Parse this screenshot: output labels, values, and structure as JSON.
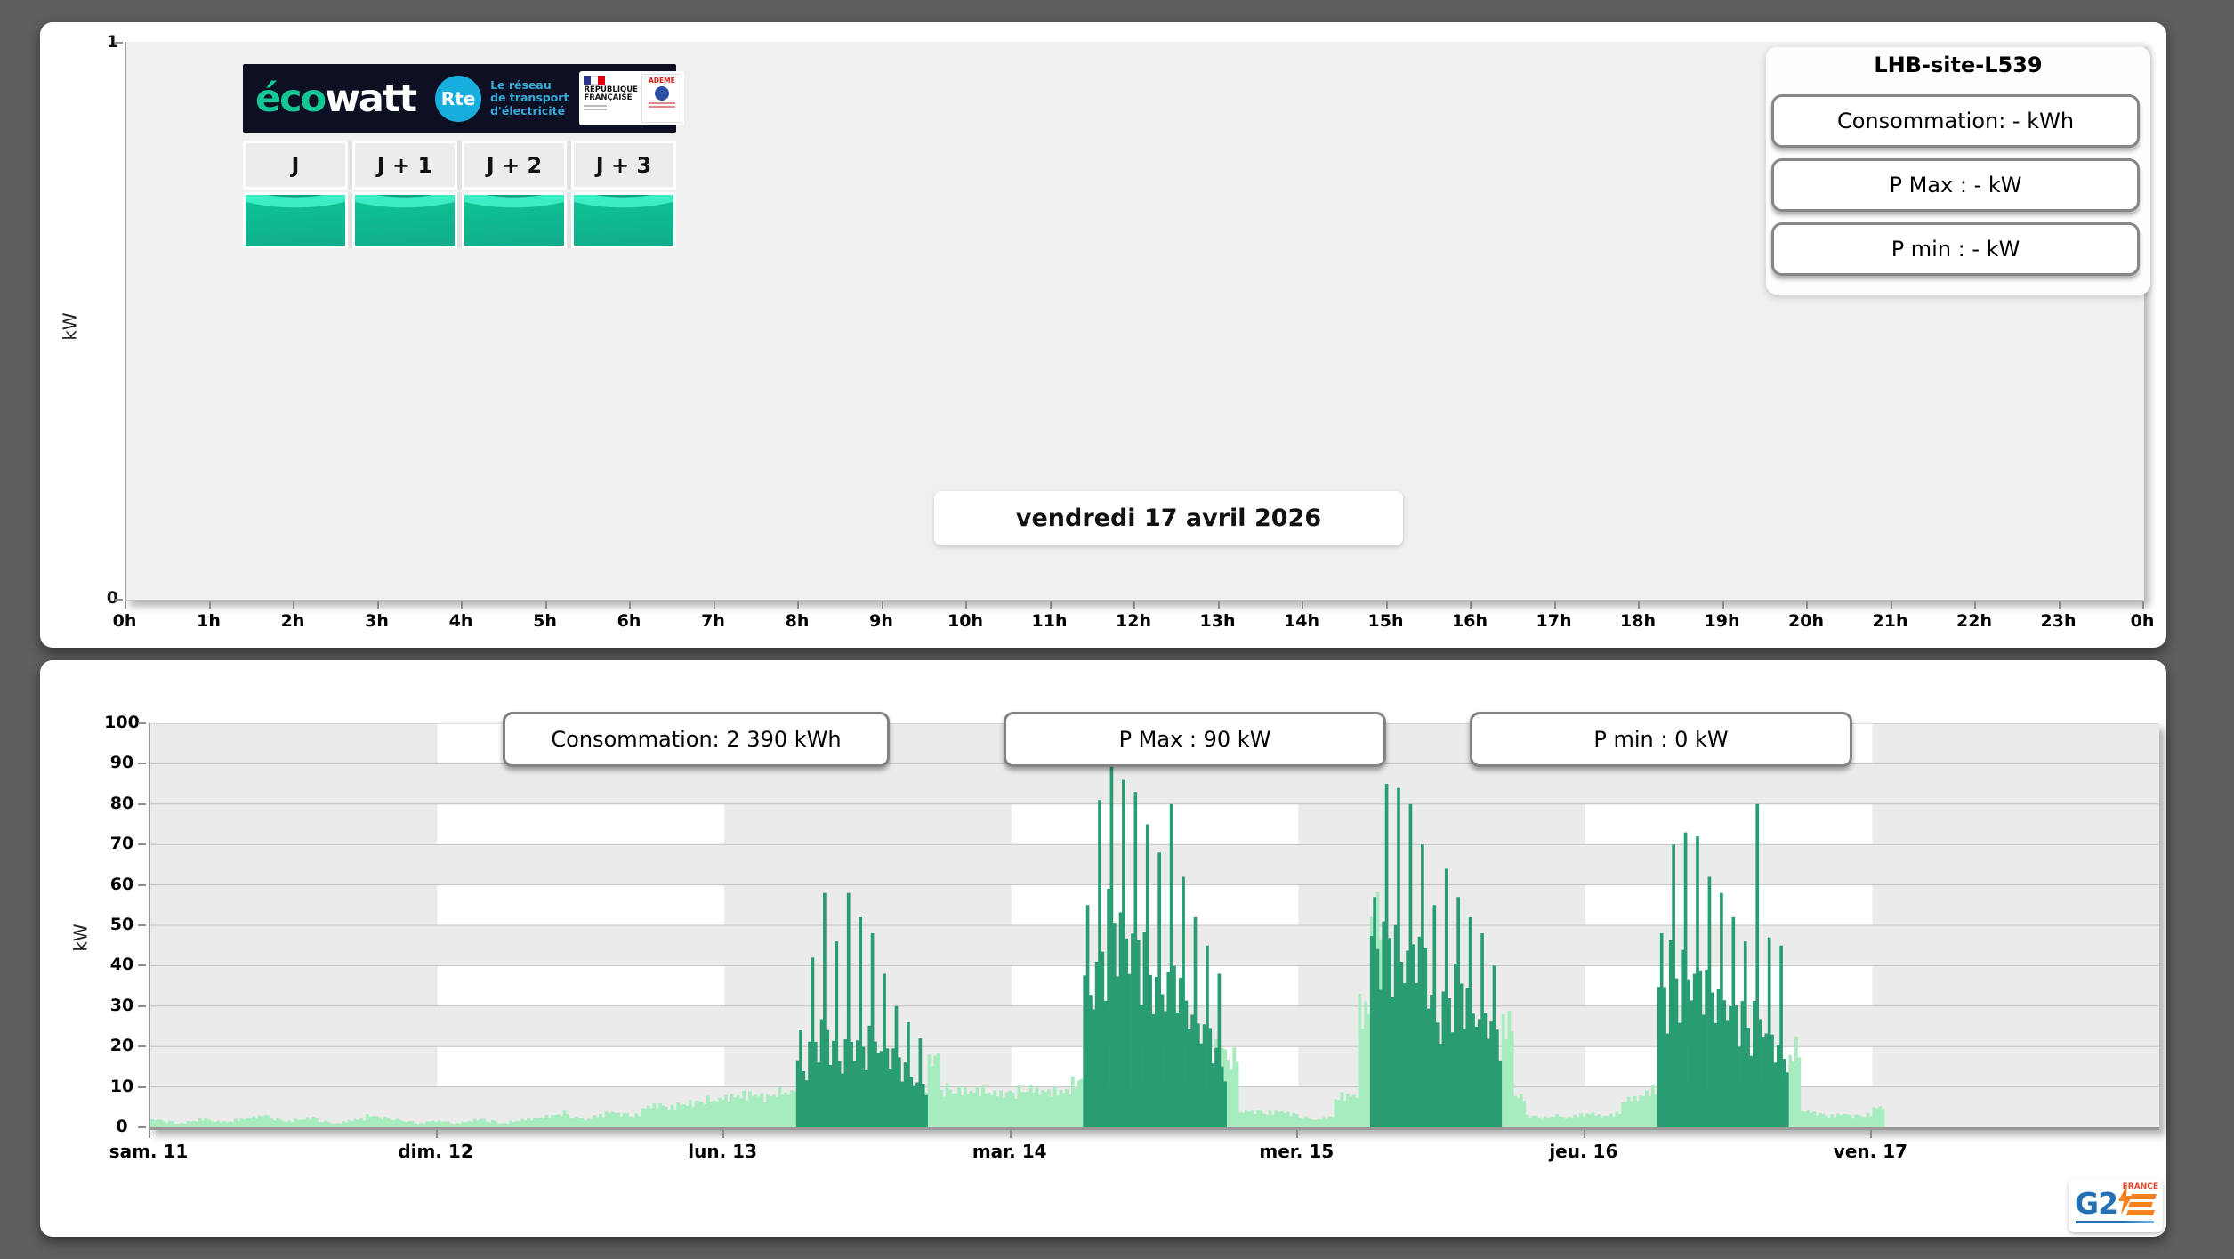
{
  "page": {
    "background": "#5e5e5e"
  },
  "top_panel": {
    "site_title": "LHB-site-L539",
    "stats": [
      "Consommation: - kWh",
      "P Max :  - kW",
      "P min : - kW"
    ],
    "date_label": "vendredi 17 avril 2026",
    "day_buttons": [
      "J",
      "J + 1",
      "J + 2",
      "J + 3"
    ],
    "signal_status_color": "#0cc695",
    "ecowatt": {
      "brand_eco": "éco",
      "brand_watt": "watt",
      "rte_abbr": "Rte",
      "rte_lines": [
        "Le réseau",
        "de transport",
        "d'électricité"
      ],
      "gov_line1": "RÉPUBLIQUE",
      "gov_line2": "FRANÇAISE",
      "ademe": "ADEME"
    },
    "y_axis": {
      "label": "kW",
      "ticks": [
        "1",
        "0"
      ]
    }
  },
  "bottom_panel": {
    "stats": [
      "Consommation: 2 390 kWh",
      "P Max :  90 kW",
      "P min : 0 kW"
    ],
    "y_axis": {
      "label": "kW"
    },
    "g2e": {
      "name": "G2",
      "country": "FRANCE"
    }
  },
  "chart_data": [
    {
      "type": "line",
      "title": "vendredi 17 avril 2026",
      "ylabel": "kW",
      "ylim": [
        0,
        1
      ],
      "grid": false,
      "x_ticks": [
        "0h",
        "1h",
        "2h",
        "3h",
        "4h",
        "5h",
        "6h",
        "7h",
        "8h",
        "9h",
        "10h",
        "11h",
        "12h",
        "13h",
        "14h",
        "15h",
        "16h",
        "17h",
        "18h",
        "19h",
        "20h",
        "21h",
        "22h",
        "23h",
        "0h"
      ],
      "series": []
    },
    {
      "type": "bar",
      "ylabel": "kW",
      "ylim": [
        0,
        100
      ],
      "y_tick_step": 10,
      "x_ticks": [
        "sam. 11",
        "dim. 12",
        "lun. 13",
        "mar. 14",
        "mer. 15",
        "jeu. 16",
        "ven. 17"
      ],
      "x_total_hours": 168,
      "background_pattern": "checkerboard: white cell when day-column index odd and 10kW-band index odd, else light gray",
      "colors": {
        "light": "#a6ecbf",
        "dark": "#2a9c72",
        "grid": "#c4c4c4",
        "cell_gray": "#ebebeb",
        "cell_white": "#ffffff"
      },
      "totals": {
        "consommation_kwh": "2 390",
        "p_max_kw": 90,
        "p_min_kw": 0
      },
      "series": [
        {
          "name": "light_green",
          "color": "#a6ecbf",
          "unit": "kW",
          "start_hour": 0,
          "hourly": [
            2,
            1.5,
            1,
            1.5,
            2,
            1.5,
            1.5,
            2,
            2.5,
            3,
            2,
            1.5,
            2,
            2.5,
            1.5,
            1,
            1.5,
            2,
            3,
            2.5,
            2,
            1.5,
            1,
            1.5,
            1.5,
            1,
            1.5,
            2,
            1.5,
            1,
            1.5,
            2,
            2.5,
            3,
            3.5,
            2.5,
            2,
            3,
            4,
            3.5,
            3,
            5,
            5.5,
            5,
            6,
            6.5,
            7,
            7,
            7.5,
            8,
            8.5,
            8,
            9,
            9,
            10,
            10,
            10,
            10,
            10,
            10,
            10,
            10,
            10,
            10,
            10,
            18,
            9.5,
            9,
            9,
            9.5,
            9,
            9,
            9,
            9.5,
            9,
            9,
            9.5,
            12,
            28,
            10,
            10,
            10,
            10,
            10,
            10,
            10,
            10,
            10,
            10,
            20,
            18,
            4,
            4,
            3.5,
            4,
            3.5,
            2.5,
            2,
            2.5,
            7.5,
            8,
            30,
            55,
            10,
            10,
            10,
            10,
            10,
            10,
            10,
            10,
            10,
            10,
            26,
            8,
            3,
            2.5,
            3,
            2.5,
            3,
            3.5,
            3,
            3.5,
            7,
            7.5,
            9,
            26,
            10,
            10,
            10,
            10,
            10,
            10,
            10,
            10,
            10,
            10,
            19,
            4,
            3.5,
            3,
            3.5,
            3,
            3,
            5
          ]
        },
        {
          "name": "dark_green",
          "color": "#2a9c72",
          "unit": "kW",
          "segments": [
            {
              "start_hour": 54,
              "base": [
                16,
                22,
                25,
                20,
                24,
                22,
                25,
                20,
                18,
                15,
                12
              ],
              "peak": [
                24,
                42,
                58,
                46,
                58,
                52,
                48,
                38,
                30,
                26,
                22
              ]
            },
            {
              "start_hour": 78,
              "base": [
                40,
                45,
                55,
                52,
                48,
                45,
                40,
                42,
                35,
                28,
                25,
                18
              ],
              "peak": [
                55,
                81,
                90,
                86,
                83,
                75,
                68,
                80,
                62,
                52,
                45,
                38
              ]
            },
            {
              "start_hour": 102,
              "base": [
                50,
                52,
                50,
                48,
                45,
                30,
                35,
                40,
                35,
                30,
                25
              ],
              "peak": [
                57,
                85,
                84,
                80,
                70,
                55,
                64,
                57,
                52,
                48,
                40
              ]
            },
            {
              "start_hour": 126,
              "base": [
                35,
                42,
                45,
                42,
                38,
                35,
                30,
                28,
                32,
                25,
                20
              ],
              "peak": [
                48,
                70,
                73,
                72,
                62,
                58,
                52,
                46,
                80,
                47,
                45
              ]
            }
          ]
        }
      ]
    }
  ]
}
